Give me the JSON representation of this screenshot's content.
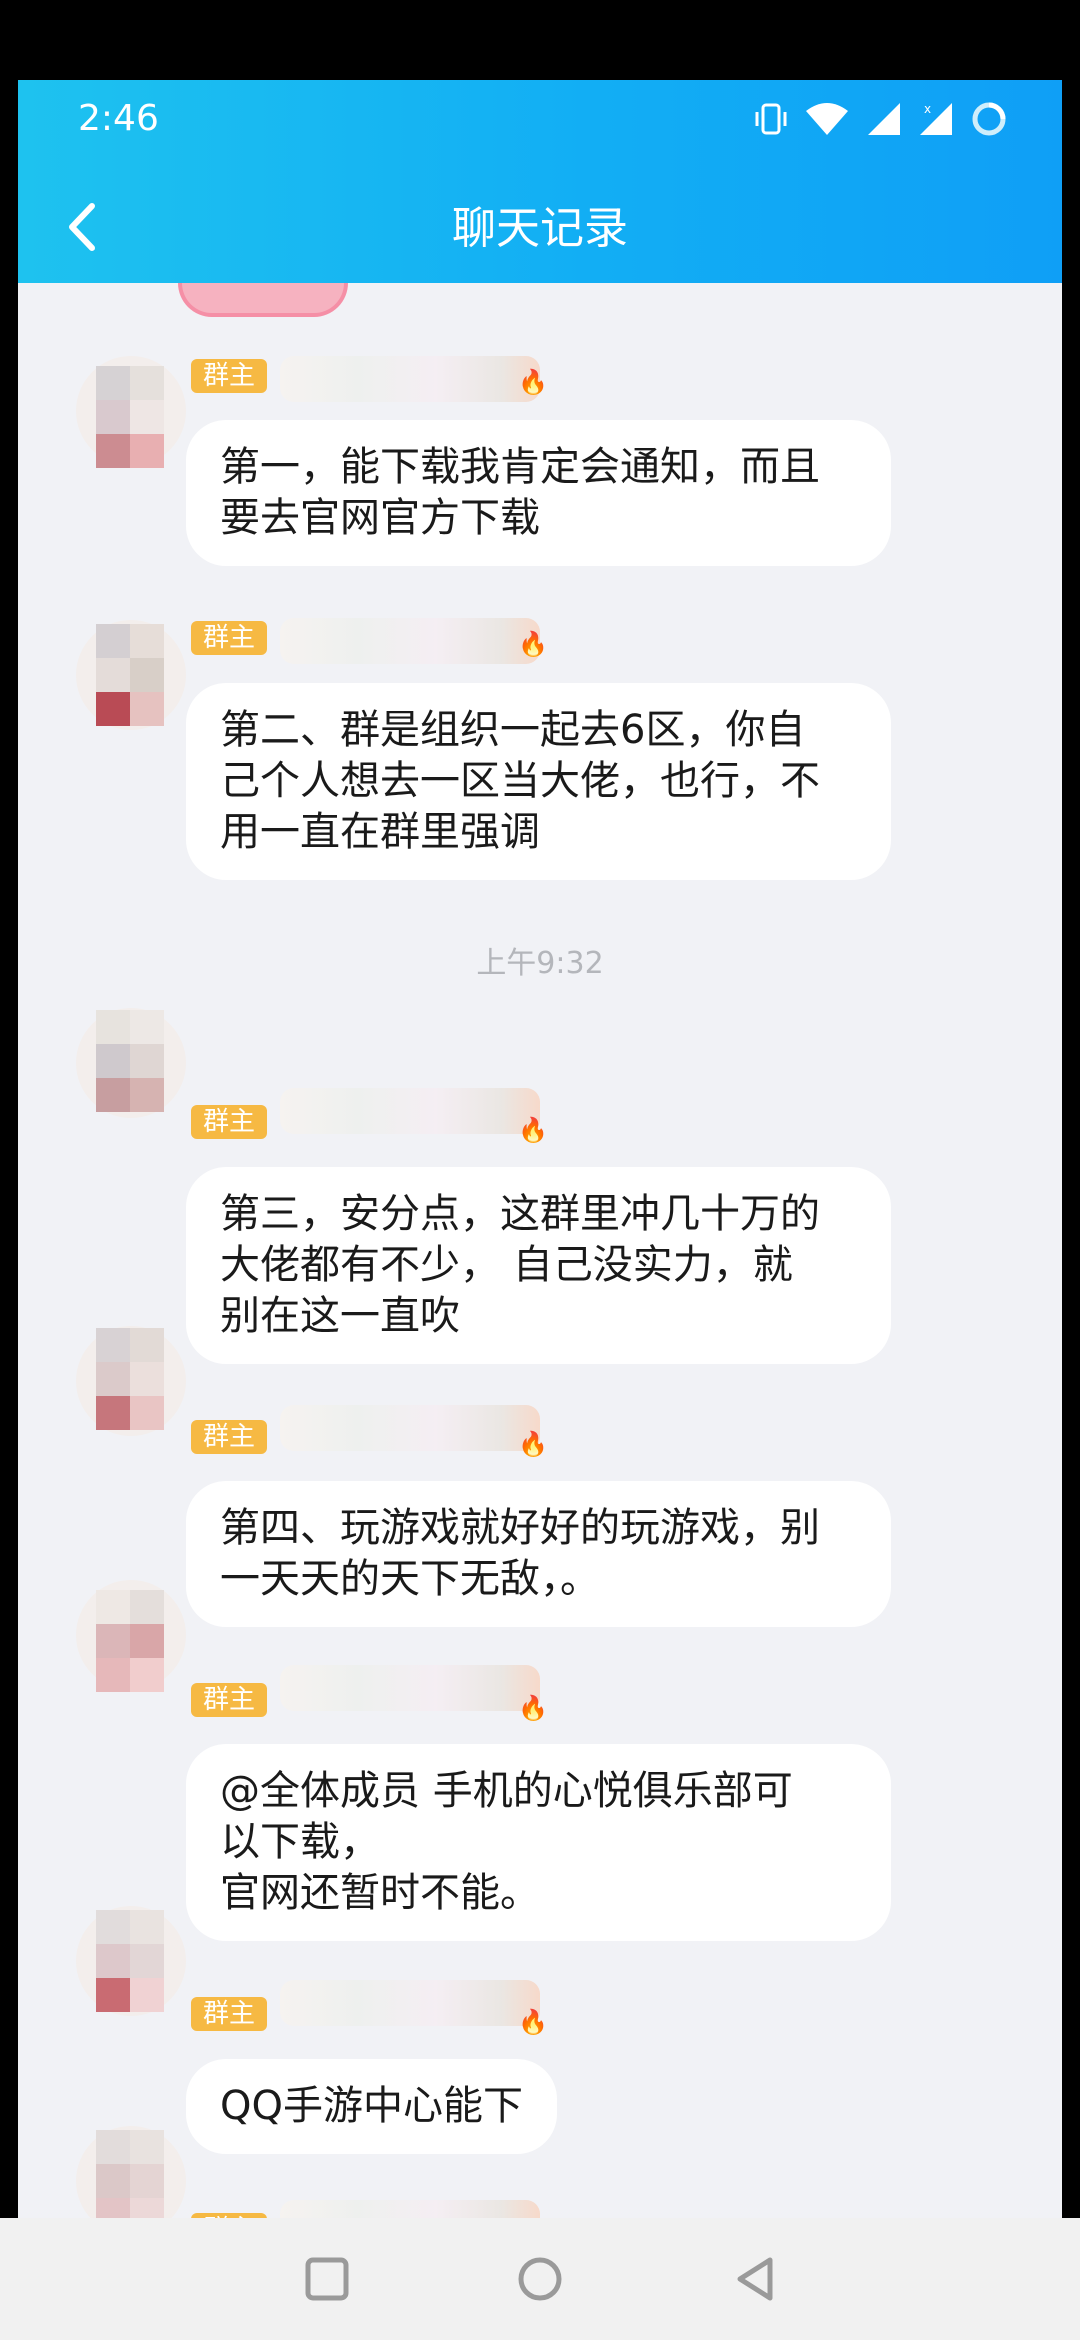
{
  "status_bar": {
    "time": "2:46"
  },
  "header": {
    "title": "聊天记录"
  },
  "badge_label": "群主",
  "timestamp": "上午9:32",
  "messages": [
    {
      "text": "第一，能下载我肯定会通知，而且\n要去官网官方下载"
    },
    {
      "text": "第二、群是组织一起去6区，你自\n己个人想去一区当大佬，也行，不\n用一直在群里强调"
    },
    {
      "text": "第三，安分点，这群里冲几十万的\n大佬都有不少， 自己没实力，就\n别在这一直吹"
    },
    {
      "text": "第四、玩游戏就好好的玩游戏，别\n一天天的天下无敌，。"
    },
    {
      "text": "@全体成员    手机的心悦俱乐部可\n以下载，\n 官网还暂时不能。"
    },
    {
      "text": "QQ手游中心能下"
    },
    {
      "text": ""
    }
  ],
  "icons": [
    "vibrate-icon",
    "wifi-icon",
    "signal-icon",
    "signal-2-icon",
    "sync-icon",
    "back-arrow-icon",
    "crown-icon",
    "recent-apps-icon",
    "home-icon",
    "back-icon"
  ],
  "colors": {
    "header_start": "#1ec2ef",
    "header_end": "#0f9ff6",
    "badge": "#f6b943",
    "background": "#f1f2f6"
  }
}
